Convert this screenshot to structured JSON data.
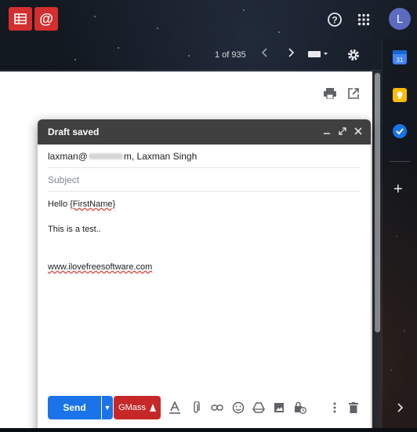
{
  "topbar": {
    "gmass_sheets_icon": "spreadsheet-icon",
    "gmass_at_icon": "at-sign-icon",
    "help_icon": "help-icon",
    "apps_icon": "apps-grid-icon",
    "avatar_letter": "L"
  },
  "toolbar": {
    "pager": "1 of 935"
  },
  "compose": {
    "title": "Draft saved",
    "to_prefix": "laxman@",
    "to_suffix": "m, Laxman Singh",
    "subject_placeholder": "Subject",
    "greeting_prefix": "Hello ",
    "greeting_token": "{FirstName}",
    "body_line": "This is a test..",
    "link": "www.ilovefreesoftware.com",
    "send_label": "Send",
    "gmass_label": "GMass"
  },
  "colors": {
    "send_blue": "#1a73e8",
    "gmass_red": "#c62828",
    "header_gray": "#404040"
  }
}
